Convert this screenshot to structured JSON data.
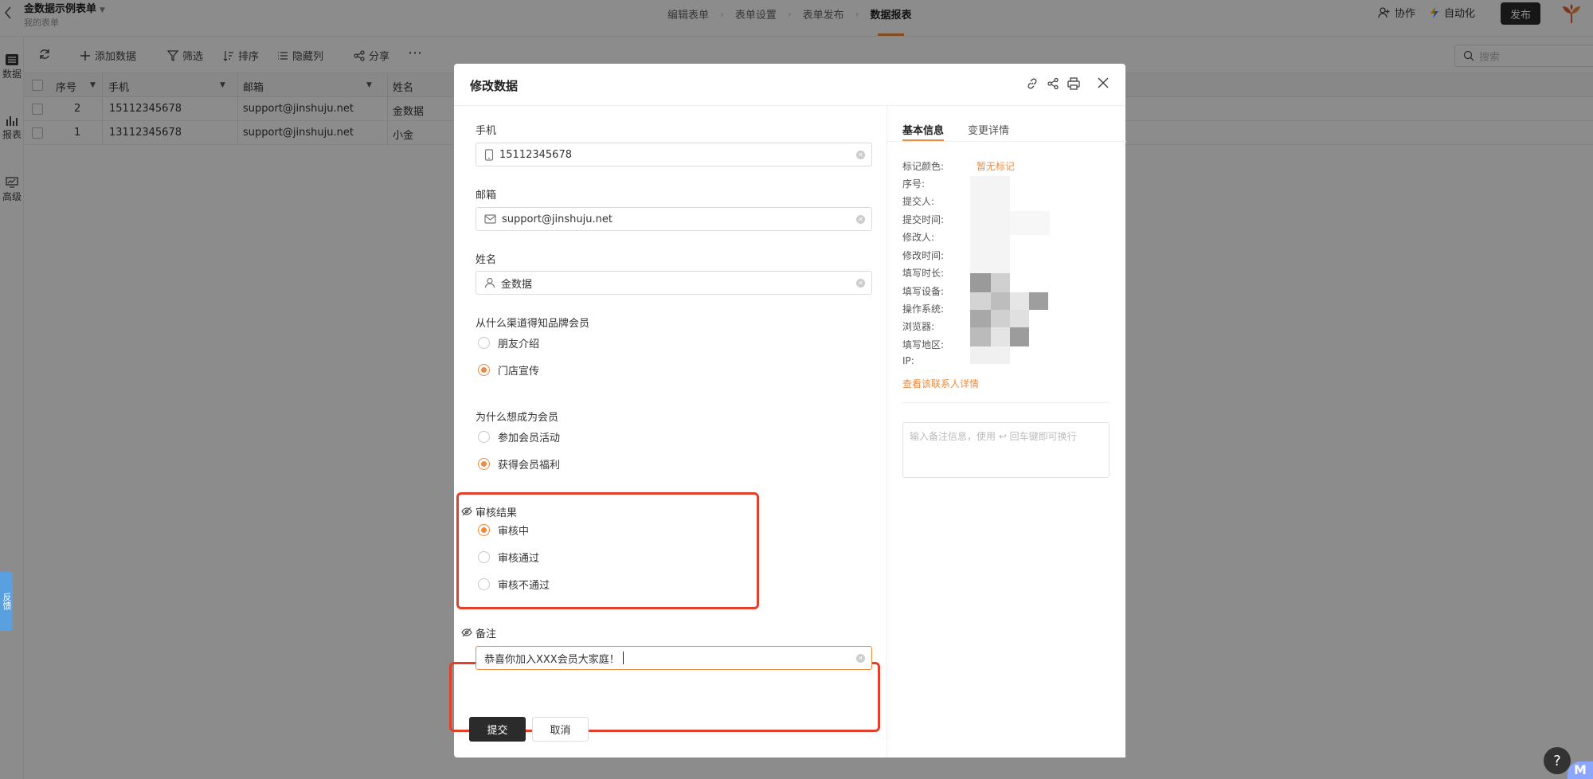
{
  "header": {
    "form_title": "金数据示例表单",
    "form_sub": "我的表单",
    "steps": [
      "编辑表单",
      "表单设置",
      "表单发布",
      "数据报表"
    ],
    "collab": "协作",
    "automation": "自动化",
    "publish": "发布"
  },
  "leftnav": {
    "items": [
      "数据",
      "报表",
      "高级"
    ]
  },
  "toolbar": {
    "add": "添加数据",
    "filter": "筛选",
    "sort": "排序",
    "hide_cols": "隐藏列",
    "share": "分享",
    "search_placeholder": "搜索"
  },
  "table": {
    "columns": [
      "序号",
      "手机",
      "邮箱",
      "姓名"
    ],
    "rows": [
      {
        "seq": "2",
        "phone": "15112345678",
        "email": "support@jinshuju.net",
        "name": "金数据"
      },
      {
        "seq": "1",
        "phone": "13112345678",
        "email": "support@jinshuju.net",
        "name": "小金"
      }
    ]
  },
  "feedback": "反馈",
  "help": "?",
  "modal": {
    "title": "修改数据",
    "fields": {
      "phone_label": "手机",
      "phone_value": "15112345678",
      "email_label": "邮箱",
      "email_value": "support@jinshuju.net",
      "name_label": "姓名",
      "name_value": "金数据",
      "q1_label": "从什么渠道得知品牌会员",
      "q1_options": [
        "朋友介绍",
        "门店宣传"
      ],
      "q2_label": "为什么想成为会员",
      "q2_options": [
        "参加会员活动",
        "获得会员福利"
      ],
      "review_label": "审核结果",
      "review_options": [
        "审核中",
        "审核通过",
        "审核不通过"
      ],
      "remark_label": "备注",
      "remark_value": "恭喜你加入XXX会员大家庭！"
    },
    "submit": "提交",
    "cancel": "取消",
    "side": {
      "tabs": [
        "基本信息",
        "变更详情"
      ],
      "meta_labels": [
        "标记颜色:",
        "序号:",
        "提交人:",
        "提交时间:",
        "修改人:",
        "修改时间:",
        "填写时长:",
        "填写设备:",
        "操作系统:",
        "浏览器:",
        "填写地区:",
        "IP:"
      ],
      "mark_value": "暂无标记",
      "contact_link": "查看该联系人详情",
      "note_placeholder": "输入备注信息，使用 ↩ 回车键即可换行"
    }
  },
  "colors": {
    "accent": "#f08a3c",
    "highlight": "#e2402b",
    "dark": "#2b2b2b"
  }
}
